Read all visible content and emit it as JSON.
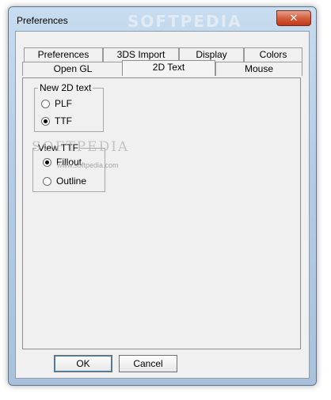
{
  "window": {
    "title": "Preferences",
    "watermark": "SOFTPEDIA",
    "close_glyph": "✕"
  },
  "tabs": {
    "row1": [
      "Preferences",
      "3DS Import",
      "Display",
      "Colors"
    ],
    "row2": [
      "Open GL",
      "2D Text",
      "Mouse"
    ],
    "active": "2D Text"
  },
  "new_2d_text": {
    "legend": "New 2D text",
    "options": [
      "PLF",
      "TTF"
    ],
    "selected": "TTF"
  },
  "view_ttf": {
    "legend": "View TTF",
    "options": [
      "Fillout",
      "Outline"
    ],
    "selected": "Fillout"
  },
  "watermark": {
    "mark": "SOFTPEDIA",
    "url": "www.softpedia.com"
  },
  "buttons": {
    "ok": "OK",
    "cancel": "Cancel"
  }
}
